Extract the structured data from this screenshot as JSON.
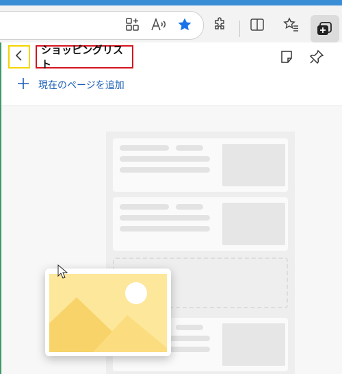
{
  "browser": {
    "toolbar_icons": [
      "add-tab-to-collection-icon",
      "read-aloud-icon",
      "favorite-star-icon",
      "extensions-icon",
      "split-screen-icon",
      "favorites-icon",
      "collections-icon"
    ],
    "accent_color": "#1a73e8"
  },
  "panel": {
    "title": "ショッピングリスト",
    "add_current_page_label": "現在のページを追加",
    "header_icons": [
      "note-icon",
      "pin-icon"
    ],
    "highlight_back_color": "#f5d400",
    "highlight_title_color": "#d4141e"
  },
  "placeholder": {
    "illustration": "image-placeholder-icon"
  }
}
